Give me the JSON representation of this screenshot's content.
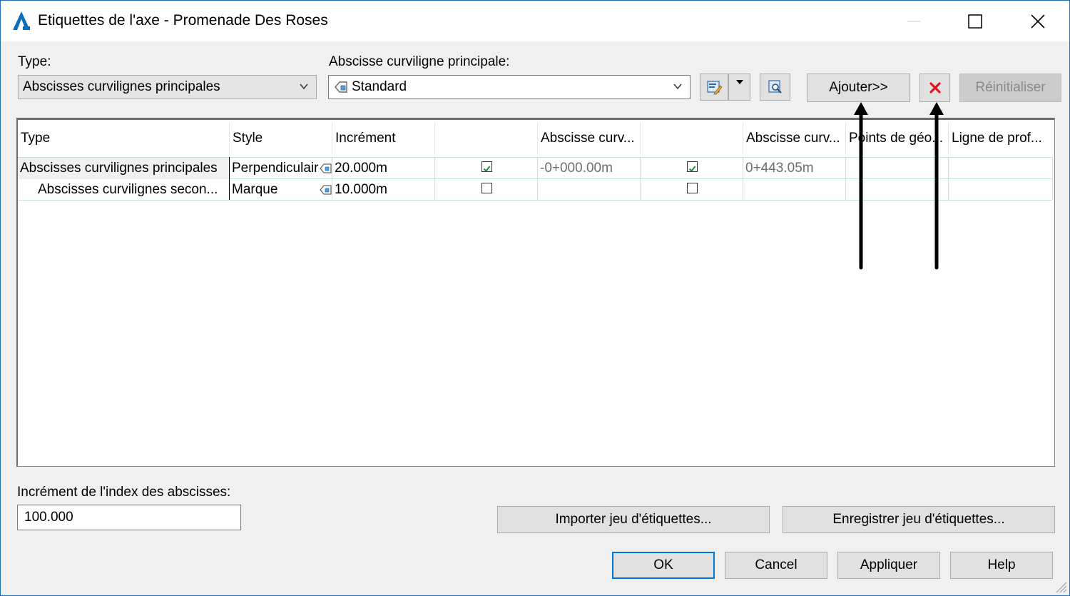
{
  "window": {
    "title": "Etiquettes de l'axe - Promenade Des Roses",
    "icon": "autocad-civil-icon"
  },
  "type_section": {
    "label": "Type:",
    "selected": "Abscisses curvilignes principales"
  },
  "major_station": {
    "label": "Abscisse curviligne principale:",
    "selected": "Standard",
    "icon": "label-style-icon"
  },
  "toolbar": {
    "edit_style_icon": "edit-style-icon",
    "dropdown_icon": "dropdown-arrow-icon",
    "preview_icon": "preview-icon",
    "add_label": "Ajouter>>",
    "delete_icon": "red-x-icon",
    "reset_label": "Réinitialiser"
  },
  "grid": {
    "columns": [
      "Type",
      "Style",
      "Incrément",
      "",
      "Abscisse curv...",
      "",
      "Abscisse curv...",
      "Points de géo...",
      "Ligne de prof..."
    ],
    "rows": [
      {
        "type": "Abscisses curvilignes principales",
        "style": "Perpendiculair",
        "increment": "20.000m",
        "check1": true,
        "start": "-0+000.00m",
        "check2": true,
        "end": "0+443.05m",
        "geo": "",
        "profile": ""
      },
      {
        "type": "Abscisses curvilignes secon...",
        "style": "Marque",
        "increment": "10.000m",
        "check1": false,
        "start": "",
        "check2": false,
        "end": "",
        "geo": "",
        "profile": ""
      }
    ]
  },
  "station_index": {
    "label": "Incrément de l'index des abscisses:",
    "value": "100.000"
  },
  "buttons": {
    "import": "Importer jeu d'étiquettes...",
    "save": "Enregistrer jeu d'étiquettes...",
    "ok": "OK",
    "cancel": "Cancel",
    "apply": "Appliquer",
    "help": "Help"
  },
  "colors": {
    "accent": "#0078d7",
    "delete_red": "#e0141e",
    "check_green": "#1a8f3a",
    "grid_line": "#bfe6e0"
  }
}
